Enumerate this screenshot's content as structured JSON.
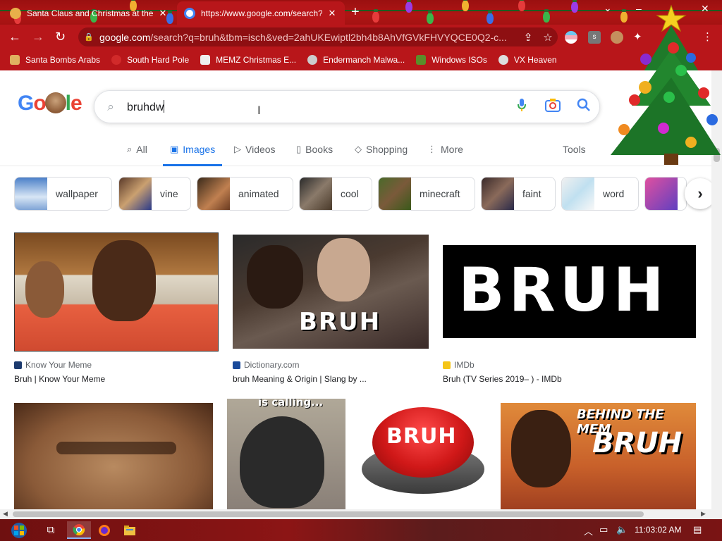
{
  "tabs": [
    {
      "title": "Santa Claus and Christmas at the",
      "active": false
    },
    {
      "title": "https://www.google.com/search?",
      "active": true
    }
  ],
  "window_controls": {
    "minimize": "–",
    "restore": "❐",
    "close": "✕",
    "tab_list": "⌄",
    "new_tab": "+"
  },
  "address_bar": {
    "host": "google.com",
    "path": "/search?q=bruh&tbm=isch&ved=2ahUKEwiptl2bh4b8AhVfGVkFHVYQCE0Q2-c..."
  },
  "bookmarks": [
    {
      "label": "Santa Bombs Arabs",
      "icon": "santa-icon"
    },
    {
      "label": "South Hard Pole",
      "icon": "ornament-icon"
    },
    {
      "label": "MEMZ Christmas E...",
      "icon": "page-icon"
    },
    {
      "label": "Endermanch Malwa...",
      "icon": "raccoon-icon"
    },
    {
      "label": "Windows ISOs",
      "icon": "tree-icon"
    },
    {
      "label": "VX Heaven",
      "icon": "skull-icon"
    }
  ],
  "search": {
    "query": "bruhdw"
  },
  "nav_tabs": [
    {
      "label": "All",
      "icon": "search-icon",
      "active": false
    },
    {
      "label": "Images",
      "icon": "image-icon",
      "active": true
    },
    {
      "label": "Videos",
      "icon": "play-icon",
      "active": false
    },
    {
      "label": "Books",
      "icon": "book-icon",
      "active": false
    },
    {
      "label": "Shopping",
      "icon": "tag-icon",
      "active": false
    },
    {
      "label": "More",
      "icon": "dots-icon",
      "active": false
    }
  ],
  "tools_label": "Tools",
  "chips": [
    {
      "label": "wallpaper"
    },
    {
      "label": "vine"
    },
    {
      "label": "animated"
    },
    {
      "label": "cool"
    },
    {
      "label": "minecraft"
    },
    {
      "label": "faint"
    },
    {
      "label": "word"
    },
    {
      "label": ""
    }
  ],
  "results_row1": [
    {
      "source": "Know Your Meme",
      "title": "Bruh | Know Your Meme"
    },
    {
      "source": "Dictionary.com",
      "title": "bruh Meaning & Origin | Slang by ...",
      "overlay": "BRUH"
    },
    {
      "source": "IMDb",
      "title": "Bruh (TV Series 2019– ) - IMDb",
      "overlay": "BRUH"
    }
  ],
  "results_row2": [
    {
      "overlay": ""
    },
    {
      "overlay": "is calling..."
    },
    {
      "overlay": "BRUH"
    },
    {
      "overlay": "BEHIND THE MEM",
      "overlay2": "BRUH"
    }
  ],
  "taskbar": {
    "clock": "11:03:02 AM"
  },
  "colors": {
    "google_blue": "#4285F4",
    "google_red": "#EA4335",
    "google_yellow": "#FBBC05",
    "google_green": "#34A853",
    "chrome_theme": "#b8161a",
    "active_tab_blue": "#1a73e8"
  }
}
